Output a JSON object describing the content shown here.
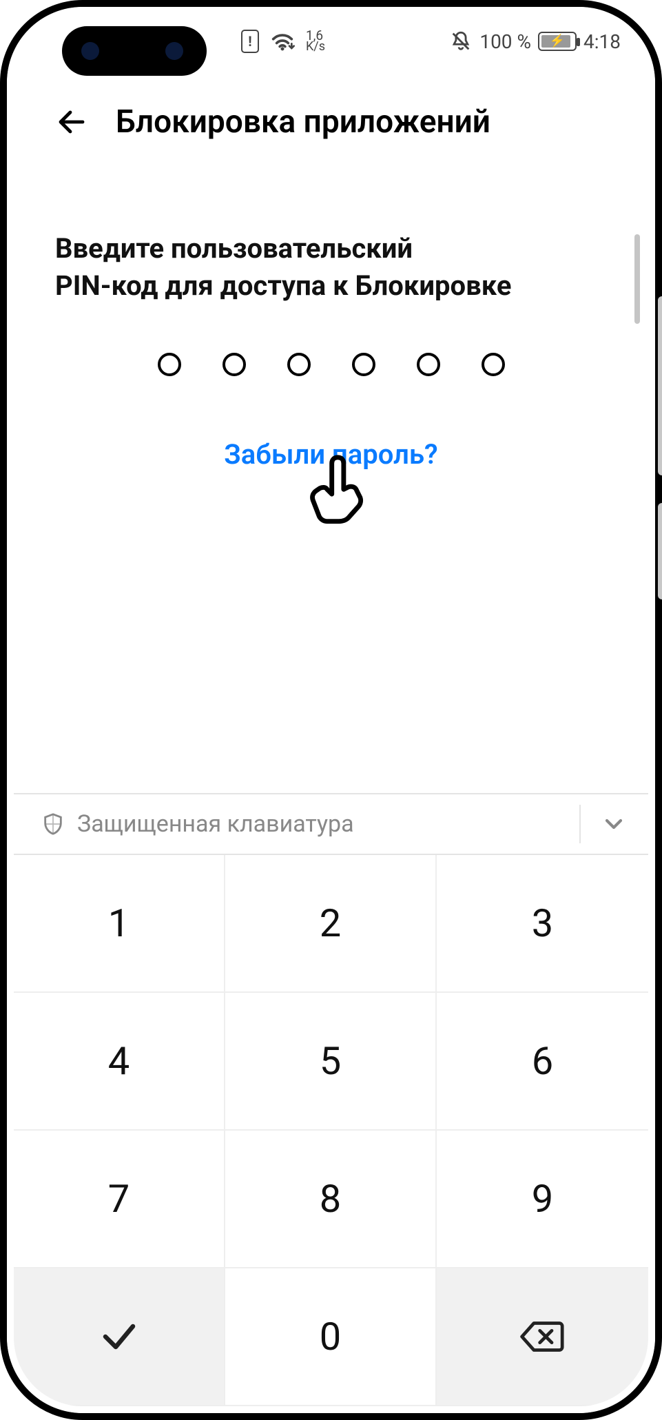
{
  "status": {
    "net_rate_top": "1,6",
    "net_rate_bottom": "K/s",
    "battery_pct": "100 %",
    "time": "4:18"
  },
  "header": {
    "title": "Блокировка приложений"
  },
  "content": {
    "prompt_line1": "Введите пользовательский",
    "prompt_line2": "PIN-код для доступа к Блокировке",
    "forgot_label": "Забыли пароль?",
    "pin_length": 6
  },
  "keyboard": {
    "secure_label": "Защищенная клавиатура",
    "keys": [
      "1",
      "2",
      "3",
      "4",
      "5",
      "6",
      "7",
      "8",
      "9",
      "ok",
      "0",
      "backspace"
    ]
  }
}
